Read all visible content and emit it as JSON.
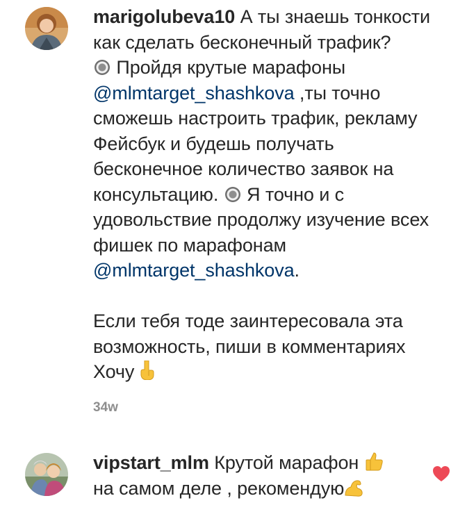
{
  "comments": [
    {
      "username": "marigolubeva10",
      "lines": [
        " А ты знаешь тонкости",
        "как сделать бесконечный трафик?",
        "Пройдя крутые марафоны",
        "@mlmtarget_shashkova",
        " ,ты точно",
        "сможешь настроить трафик, рекламу",
        "Фейсбук и будешь получать",
        "бесконечное количество заявок на",
        "консультацию.",
        " Я точно и с",
        "удовольствие продолжу изучение всех",
        "фишек по марафонам",
        "@mlmtarget_shashkova",
        ".",
        "Если тебя тоде заинтересовала эта",
        "возможность, пиши в комментариях",
        "Хочу"
      ],
      "time": "34w"
    },
    {
      "username": "vipstart_mlm",
      "lines": [
        " Крутой марафон",
        "на самом деле , рекомендую"
      ]
    }
  ],
  "icons": {
    "heart": "heart-icon",
    "point_down": "point-down-emoji-icon",
    "thumbs_up": "thumbs-up-emoji-icon",
    "biceps": "biceps-emoji-icon",
    "radio_button": "radio-button-emoji-icon"
  },
  "colors": {
    "text": "#262626",
    "mention": "#003569",
    "meta": "#8e8e8e",
    "heart": "#ed4956"
  }
}
